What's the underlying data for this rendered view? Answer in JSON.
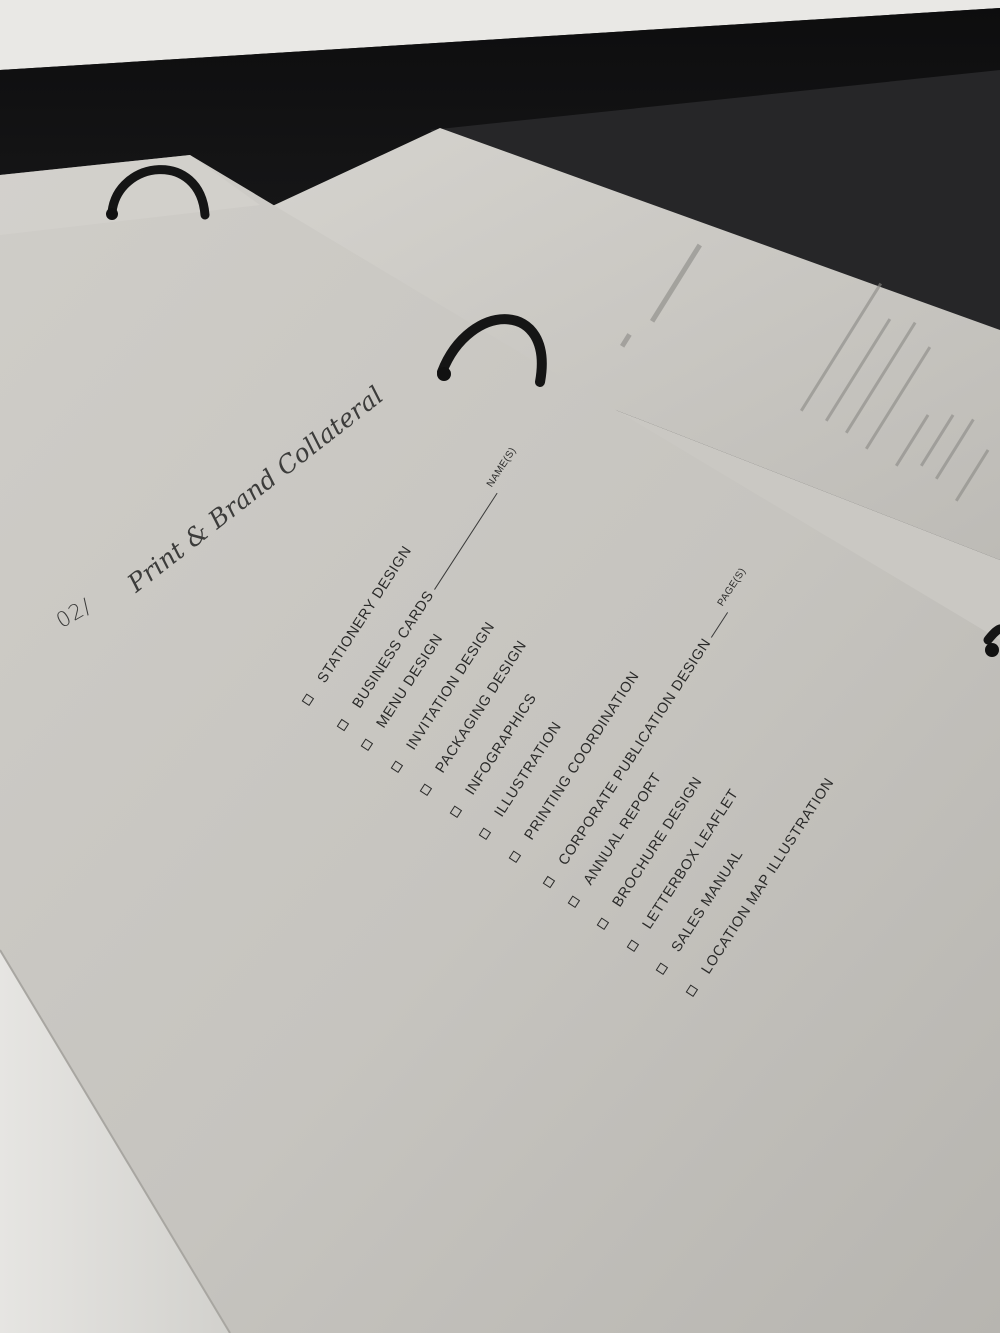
{
  "front_page": {
    "section_number": "02/",
    "section_title": "Print & Brand Collateral",
    "checklist": [
      {
        "label": "STATIONERY DESIGN"
      },
      {
        "label": "BUSINESS CARDS",
        "blank": true,
        "suffix": "NAME(S)"
      },
      {
        "label": "MENU DESIGN"
      },
      {
        "label": "INVITATION DESIGN"
      },
      {
        "label": "PACKAGING DESIGN"
      },
      {
        "label": "INFOGRAPHICS"
      },
      {
        "label": "ILLUSTRATION"
      },
      {
        "label": "PRINTING COORDINATION"
      },
      {
        "label": "CORPORATE PUBLICATION DESIGN",
        "blank": true,
        "suffix": "PAGE(S)"
      },
      {
        "label": "ANNUAL REPORT"
      },
      {
        "label": "BROCHURE DESIGN"
      },
      {
        "label": "LETTERBOX LEAFLET"
      },
      {
        "label": "SALES MANUAL"
      },
      {
        "label": "LOCATION MAP ILLUSTRATION"
      }
    ]
  },
  "colors": {
    "paper": "#c9c7c2",
    "paper_shadow": "#a9a7a2",
    "ink": "#2b2b2a",
    "tray": "#141415",
    "ring": "#151515"
  }
}
